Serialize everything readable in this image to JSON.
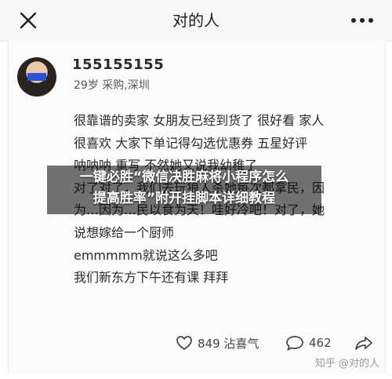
{
  "header": {
    "title": "对的人",
    "close_icon": "close-icon",
    "more_icon": "more-icon"
  },
  "post": {
    "username": "155155155",
    "user_meta": "29岁 采购,深圳",
    "lines": [
      "很靠谱的卖家 女朋友已经到货了 很好看 家人",
      "很喜欢 大家下单记得勾选优惠券 五星好评",
      "呐呐呐 重写 不然她又说我幼稚了",
      "对了对了，我们去玩狼人杀她每次都拿民，因",
      "为…因为…民以食为天！哇好冷吧！对了，她",
      "说想嫁给一个厨师",
      "emmmmm就说这么多吧",
      "我们新东方下午还有课 拜拜"
    ]
  },
  "overlay": {
    "line1": "一键必胜“微信决胜麻将小程序怎么",
    "line2": "提高胜率”附开挂脚本详细教程"
  },
  "actions": {
    "likes": "849 沾喜气",
    "comments": "462"
  },
  "watermark": "知乎 @对的人"
}
